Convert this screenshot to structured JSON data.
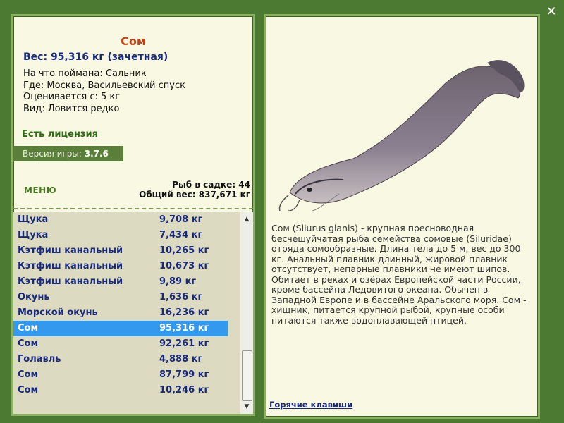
{
  "close_icon": "✕",
  "fish": {
    "name": "Сом",
    "weight": "Вес: 95,316 кг (зачетная)",
    "info": [
      "На что поймана: Сальник",
      "Где: Москва, Васильевский спуск",
      "Оценивается с: 5 кг",
      "Вид: Ловится редко"
    ],
    "license": "Есть лицензия"
  },
  "version": {
    "label": "Версия игры:",
    "value": "3.7.6"
  },
  "menu_label": "МЕНЮ",
  "stats": {
    "fish_count": "Рыб в садке: 44",
    "total_weight": "Общий вес: 837,671 кг"
  },
  "catches": [
    {
      "name": "Щука",
      "weight": "9,708 кг"
    },
    {
      "name": "Щука",
      "weight": "7,434 кг"
    },
    {
      "name": "Кэтфиш канальный",
      "weight": "10,265 кг"
    },
    {
      "name": "Кэтфиш канальный",
      "weight": "10,673 кг"
    },
    {
      "name": "Кэтфиш канальный",
      "weight": "9,89 кг"
    },
    {
      "name": "Окунь",
      "weight": "1,636 кг"
    },
    {
      "name": "Морской окунь",
      "weight": "16,236 кг"
    },
    {
      "name": "Сом",
      "weight": "95,316 кг"
    },
    {
      "name": "Сом",
      "weight": "92,261 кг"
    },
    {
      "name": "Голавль",
      "weight": "4,888 кг"
    },
    {
      "name": "Сом",
      "weight": "87,799 кг"
    },
    {
      "name": "Сом",
      "weight": "10,246 кг"
    }
  ],
  "selected_index": 7,
  "description": "Сом (Silurus glanis) - крупная пресноводная бесчешуйчатая рыба семейства сомовые (Siluridae) отряда сомообразные. Длина тела до 5 м, вес до 300 кг. Анальный плавник длинный, жировой плавник отсутствует, непарные плавники не имеют шипов. Обитает в реках и озёрах Европейской части России, кроме бассейна Ледовитого океана. Обычен в Западной Европе и в бассейне Аральского моря. Сом - хищник, питается крупной рыбой, крупные особи питаются также водоплавающей птицей.",
  "hotkeys_label": "Горячие клавиши",
  "fish_image_icon": "catfish-image",
  "colors": {
    "background": "#4d7a33",
    "panel": "#f9f8e2",
    "selected_row": "#3399ee",
    "fish_name": "#c0461a",
    "link": "#1a2a7a"
  }
}
